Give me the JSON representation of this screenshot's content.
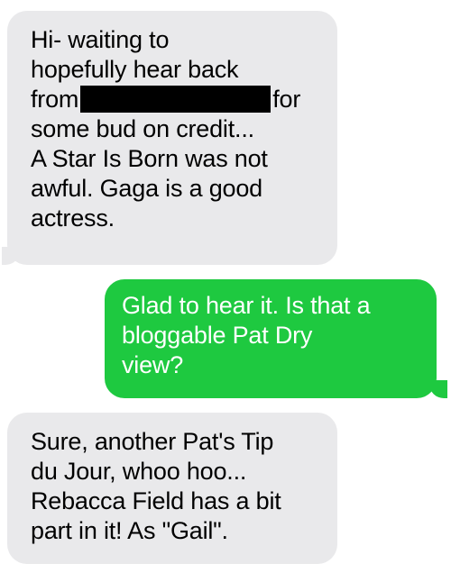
{
  "colors": {
    "incoming_bubble": "#e9e9eb",
    "outgoing_bubble": "#1ec940",
    "incoming_text": "#000000",
    "outgoing_text": "#ffffff",
    "redaction": "#000000"
  },
  "messages": [
    {
      "direction": "incoming",
      "lines": [
        "Hi- waiting to",
        "hopefully hear back",
        "from",
        "for",
        "some bud on credit...",
        "A Star Is Born was not",
        "awful. Gaga is a good",
        "actress."
      ]
    },
    {
      "direction": "outgoing",
      "lines": [
        "Glad to hear it. Is that a",
        "bloggable Pat Dry",
        "view?"
      ]
    },
    {
      "direction": "incoming",
      "lines": [
        "Sure, another Pat's Tip",
        "du Jour, whoo hoo...",
        "Rebacca Field has a bit",
        "part in it! As \"Gail\"."
      ]
    }
  ]
}
